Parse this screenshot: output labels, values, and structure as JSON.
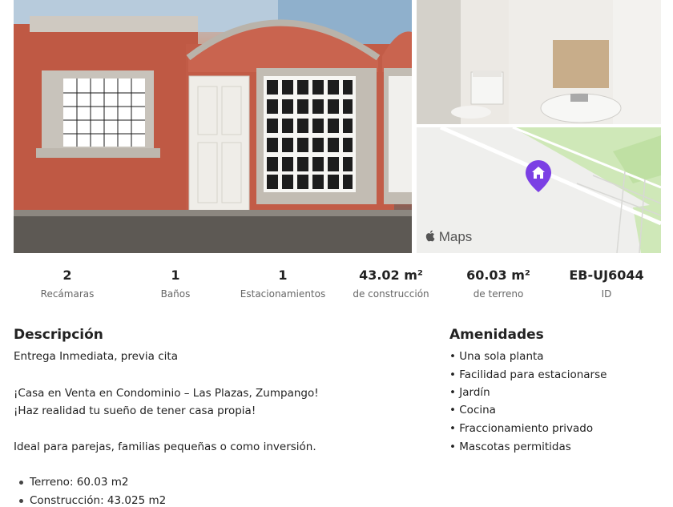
{
  "map": {
    "logo_label": "Maps"
  },
  "stats": [
    {
      "value": "2",
      "label": "Recámaras"
    },
    {
      "value": "1",
      "label": "Baños"
    },
    {
      "value": "1",
      "label": "Estacionamientos"
    },
    {
      "value": "43.02 m²",
      "label": "de construcción"
    },
    {
      "value": "60.03 m²",
      "label": "de terreno"
    },
    {
      "value": "EB-UJ6044",
      "label": "ID"
    }
  ],
  "description": {
    "title": "Descripción",
    "lines": [
      "Entrega Inmediata, previa  cita",
      "¡Casa en Venta en Condominio – Las Plazas, Zumpango!",
      "¡Haz realidad tu sueño de tener casa propia!",
      "Ideal para parejas, familias pequeñas o como inversión."
    ],
    "bullets": [
      "Terreno: 60.03 m2",
      "Construcción: 43.025 m2"
    ]
  },
  "amenities": {
    "title": "Amenidades",
    "items": [
      "• Una sola planta",
      "• Facilidad para estacionarse",
      "• Jardín",
      "• Cocina",
      "• Fraccionamiento privado",
      "• Mascotas permitidas"
    ]
  },
  "colors": {
    "pin": "#7b3fe4",
    "map_green": "#c8e6b0",
    "wall": "#b5503f"
  }
}
